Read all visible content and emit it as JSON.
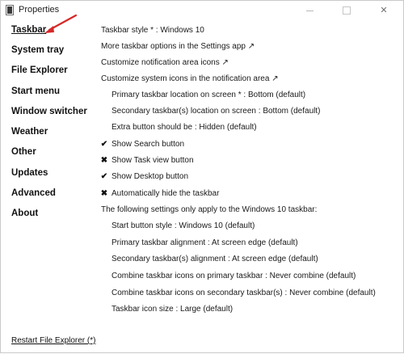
{
  "window": {
    "title": "Properties"
  },
  "sidebar": {
    "items": [
      {
        "label": "Taskbar",
        "active": true
      },
      {
        "label": "System tray"
      },
      {
        "label": "File Explorer"
      },
      {
        "label": "Start menu"
      },
      {
        "label": "Window switcher"
      },
      {
        "label": "Weather"
      },
      {
        "label": "Other"
      },
      {
        "label": "Updates"
      },
      {
        "label": "Advanced"
      },
      {
        "label": "About"
      }
    ],
    "restart_label": "Restart File Explorer (*)"
  },
  "settings": {
    "taskbar_style": "Taskbar style * : Windows 10",
    "more_options": "More taskbar options in the Settings app ↗",
    "notification_icons": "Customize notification area icons ↗",
    "system_icons": "Customize system icons in the notification area ↗",
    "primary_location": "Primary taskbar location on screen * : Bottom (default)",
    "secondary_location": "Secondary taskbar(s) location on screen : Bottom (default)",
    "extra_button": "Extra button should be : Hidden (default)",
    "show_search": {
      "label": "Show Search button",
      "mark": "✔"
    },
    "show_task_view": {
      "label": "Show Task view button",
      "mark": "✖"
    },
    "show_desktop": {
      "label": "Show Desktop button",
      "mark": "✔"
    },
    "auto_hide": {
      "label": "Automatically hide the taskbar",
      "mark": "✖"
    },
    "win10_note": "The following settings only apply to the Windows 10 taskbar:",
    "start_button_style": "Start button style : Windows 10 (default)",
    "primary_alignment": "Primary taskbar alignment : At screen edge (default)",
    "secondary_alignment": "Secondary taskbar(s) alignment : At screen edge (default)",
    "combine_primary": "Combine taskbar icons on primary taskbar : Never combine (default)",
    "combine_secondary": "Combine taskbar icons on secondary taskbar(s) : Never combine (default)",
    "icon_size": "Taskbar icon size : Large (default)"
  },
  "colors": {
    "annotation_arrow": "#d62828"
  }
}
